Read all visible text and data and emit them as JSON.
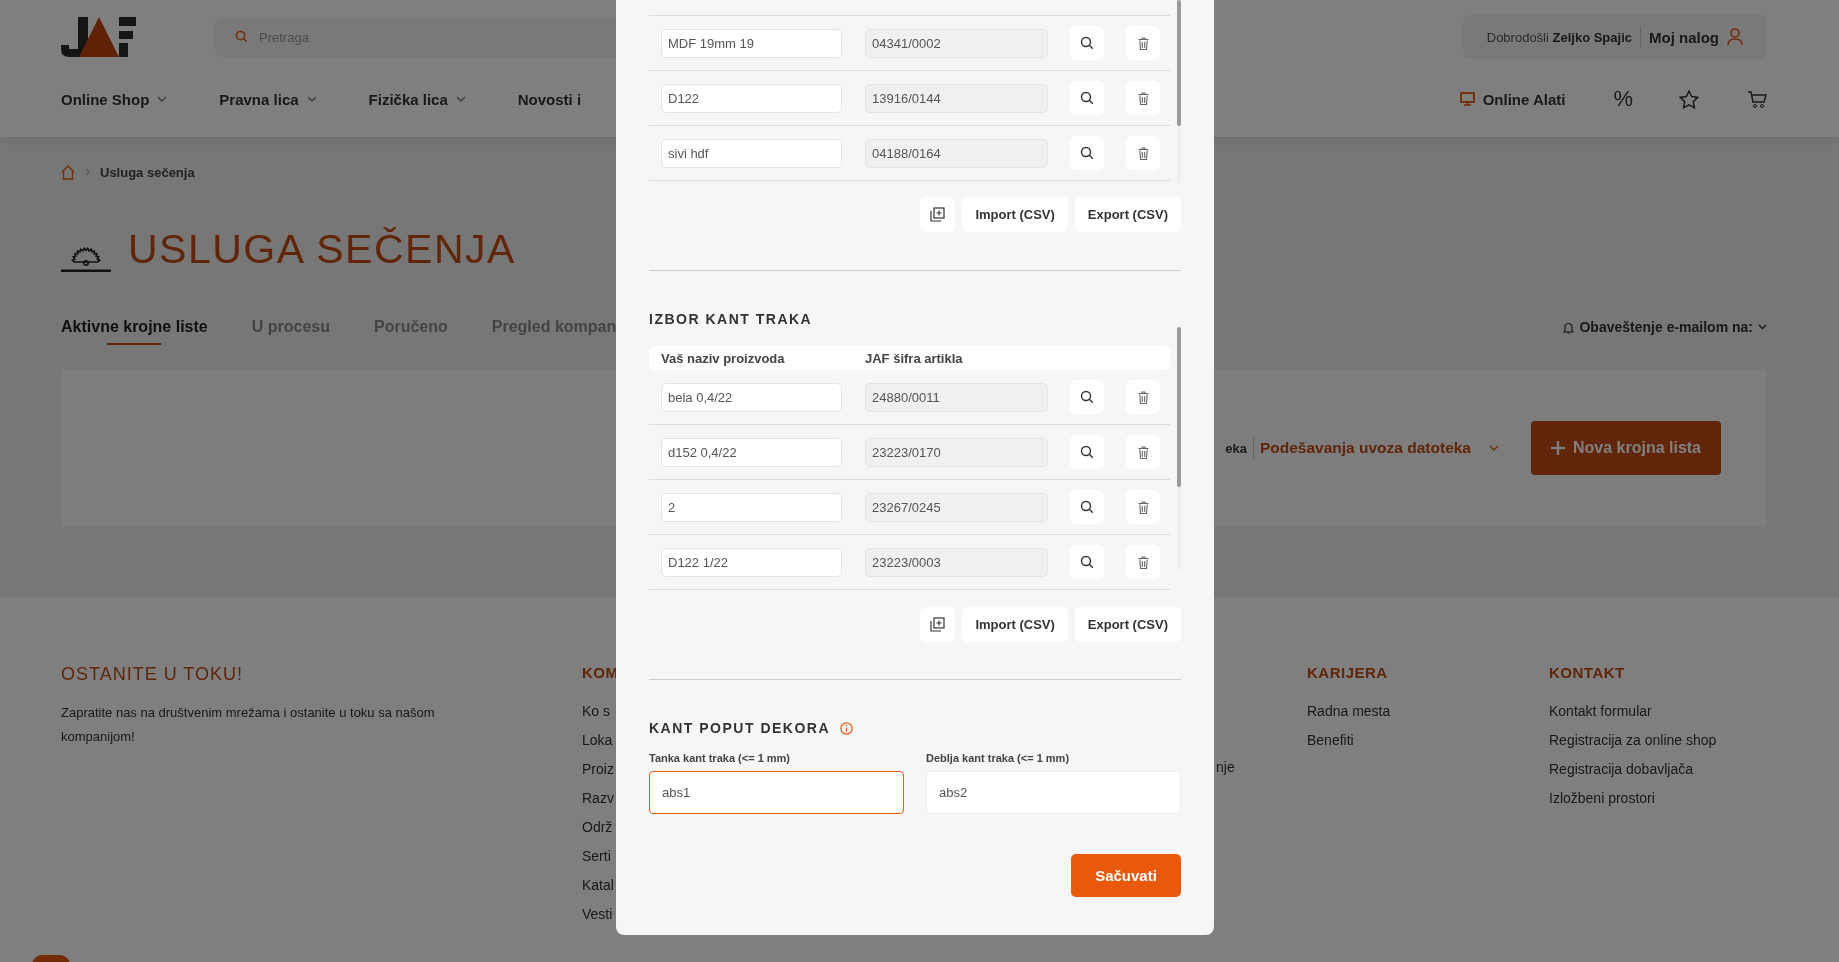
{
  "header": {
    "search": {
      "placeholder": "Pretraga"
    },
    "account": {
      "greeting": "Dobrodošli",
      "user": "Zeljko Spajic",
      "link": "Moj nalog"
    },
    "nav": [
      {
        "label": "Online Shop",
        "dropdown": true
      },
      {
        "label": "Pravna lica",
        "dropdown": true
      },
      {
        "label": "Fizička lica",
        "dropdown": true
      },
      {
        "label": "Novosti i",
        "dropdown": false
      }
    ],
    "tools": {
      "label": "Online Alati",
      "discount": "%"
    }
  },
  "breadcrumb": [
    "Usluga sečenja"
  ],
  "page_title": "USLUGA SEČENJA",
  "tabs": [
    {
      "label": "Aktivne krojne liste",
      "selected": true
    },
    {
      "label": "U procesu",
      "selected": false
    },
    {
      "label": "Poručeno",
      "selected": false
    },
    {
      "label": "Pregled kompan",
      "selected": false
    }
  ],
  "notification": "Obaveštenje e-mailom na:",
  "toolbar": {
    "partial_label": "eka",
    "import_settings": "Podešavanja uvoza datoteka",
    "new_button": "Nova krojna lista"
  },
  "footer": {
    "newsletter": {
      "title": "OSTANITE U TOKU!",
      "text": "Zapratite nas na društvenim mrežama i ostanite u toku sa našom kompanijom!"
    },
    "company": {
      "title": "KOM",
      "links": [
        "Ko s",
        "Loka",
        "Proiz",
        "Razv",
        "Održ",
        "Serti",
        "Katal",
        "Vesti"
      ]
    },
    "column_3": {
      "links": [
        "nje"
      ]
    },
    "careers": {
      "title": "KARIJERA",
      "links": [
        "Radna mesta",
        "Benefiti"
      ]
    },
    "contact": {
      "title": "KONTAKT",
      "links": [
        "Kontakt formular",
        "Registracija za online shop",
        "Registracija dobavljača",
        "Izložbeni prostori"
      ]
    }
  },
  "modal": {
    "boards": {
      "rows": [
        {
          "name": "MDF 19mm 19",
          "code": "04341/0002"
        },
        {
          "name": "D122",
          "code": "13916/0144"
        },
        {
          "name": "sivi hdf",
          "code": "04188/0164"
        }
      ],
      "buttons": [
        "Import (CSV)",
        "Export (CSV)"
      ]
    },
    "edges": {
      "title": "IZBOR KANT TRAKA",
      "columns": [
        "Vaš naziv proizvoda",
        "JAF šifra artikla"
      ],
      "rows": [
        {
          "name": "bela 0,4/22",
          "code": "24880/0011"
        },
        {
          "name": "d152 0,4/22",
          "code": "23223/0170"
        },
        {
          "name": "2",
          "code": "23267/0245"
        },
        {
          "name": "D122 1/22",
          "code": "23223/0003"
        }
      ],
      "buttons": [
        "Import (CSV)",
        "Export (CSV)"
      ]
    },
    "decor": {
      "title": "KANT POPUT DEKORA",
      "fields": [
        {
          "label": "Tanka kant traka (<= 1 mm)",
          "value": "abs1",
          "focused": true
        },
        {
          "label": "Deblja kant traka (<= 1 mm)",
          "value": "abs2",
          "focused": false
        }
      ]
    },
    "save_button": "Sačuvati"
  }
}
